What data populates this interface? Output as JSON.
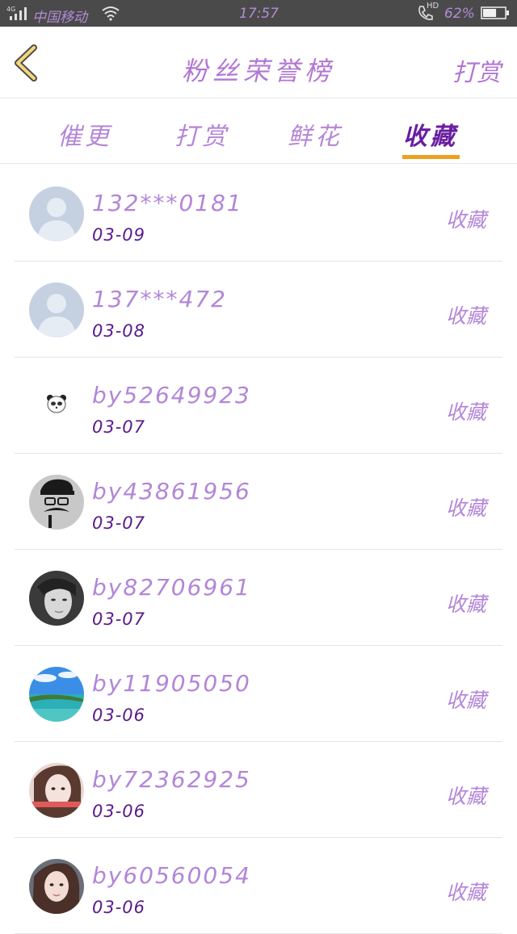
{
  "status_bar": {
    "carrier": "中国移动",
    "time": "17:57",
    "battery_percent": "62%",
    "network": "4G",
    "call_badge": "HD",
    "battery_level": 0.62
  },
  "header": {
    "title": "粉丝荣誉榜",
    "action_label": "打赏",
    "back_icon": "chevron-left-icon"
  },
  "tabs": [
    {
      "label": "催更",
      "active": false
    },
    {
      "label": "打赏",
      "active": false
    },
    {
      "label": "鲜花",
      "active": false
    },
    {
      "label": "收藏",
      "active": true
    }
  ],
  "colors": {
    "accent": "#b276d2",
    "active_tab": "#6a1da0",
    "underline": "#f0a020",
    "status_bar_bg": "#4a4a4a"
  },
  "list": [
    {
      "name": "132***0181",
      "date": "03-09",
      "action": "收藏",
      "avatar": "default-avatar-icon"
    },
    {
      "name": "137***472",
      "date": "03-08",
      "action": "收藏",
      "avatar": "default-avatar-icon"
    },
    {
      "name": "by52649923",
      "date": "03-07",
      "action": "收藏",
      "avatar": "panda-icon"
    },
    {
      "name": "by43861956",
      "date": "03-07",
      "action": "收藏",
      "avatar": "mustache-man-icon"
    },
    {
      "name": "by82706961",
      "date": "03-07",
      "action": "收藏",
      "avatar": "photo-avatar"
    },
    {
      "name": "by11905050",
      "date": "03-06",
      "action": "收藏",
      "avatar": "beach-photo-avatar"
    },
    {
      "name": "by72362925",
      "date": "03-06",
      "action": "收藏",
      "avatar": "photo-avatar"
    },
    {
      "name": "by60560054",
      "date": "03-06",
      "action": "收藏",
      "avatar": "photo-avatar"
    }
  ]
}
